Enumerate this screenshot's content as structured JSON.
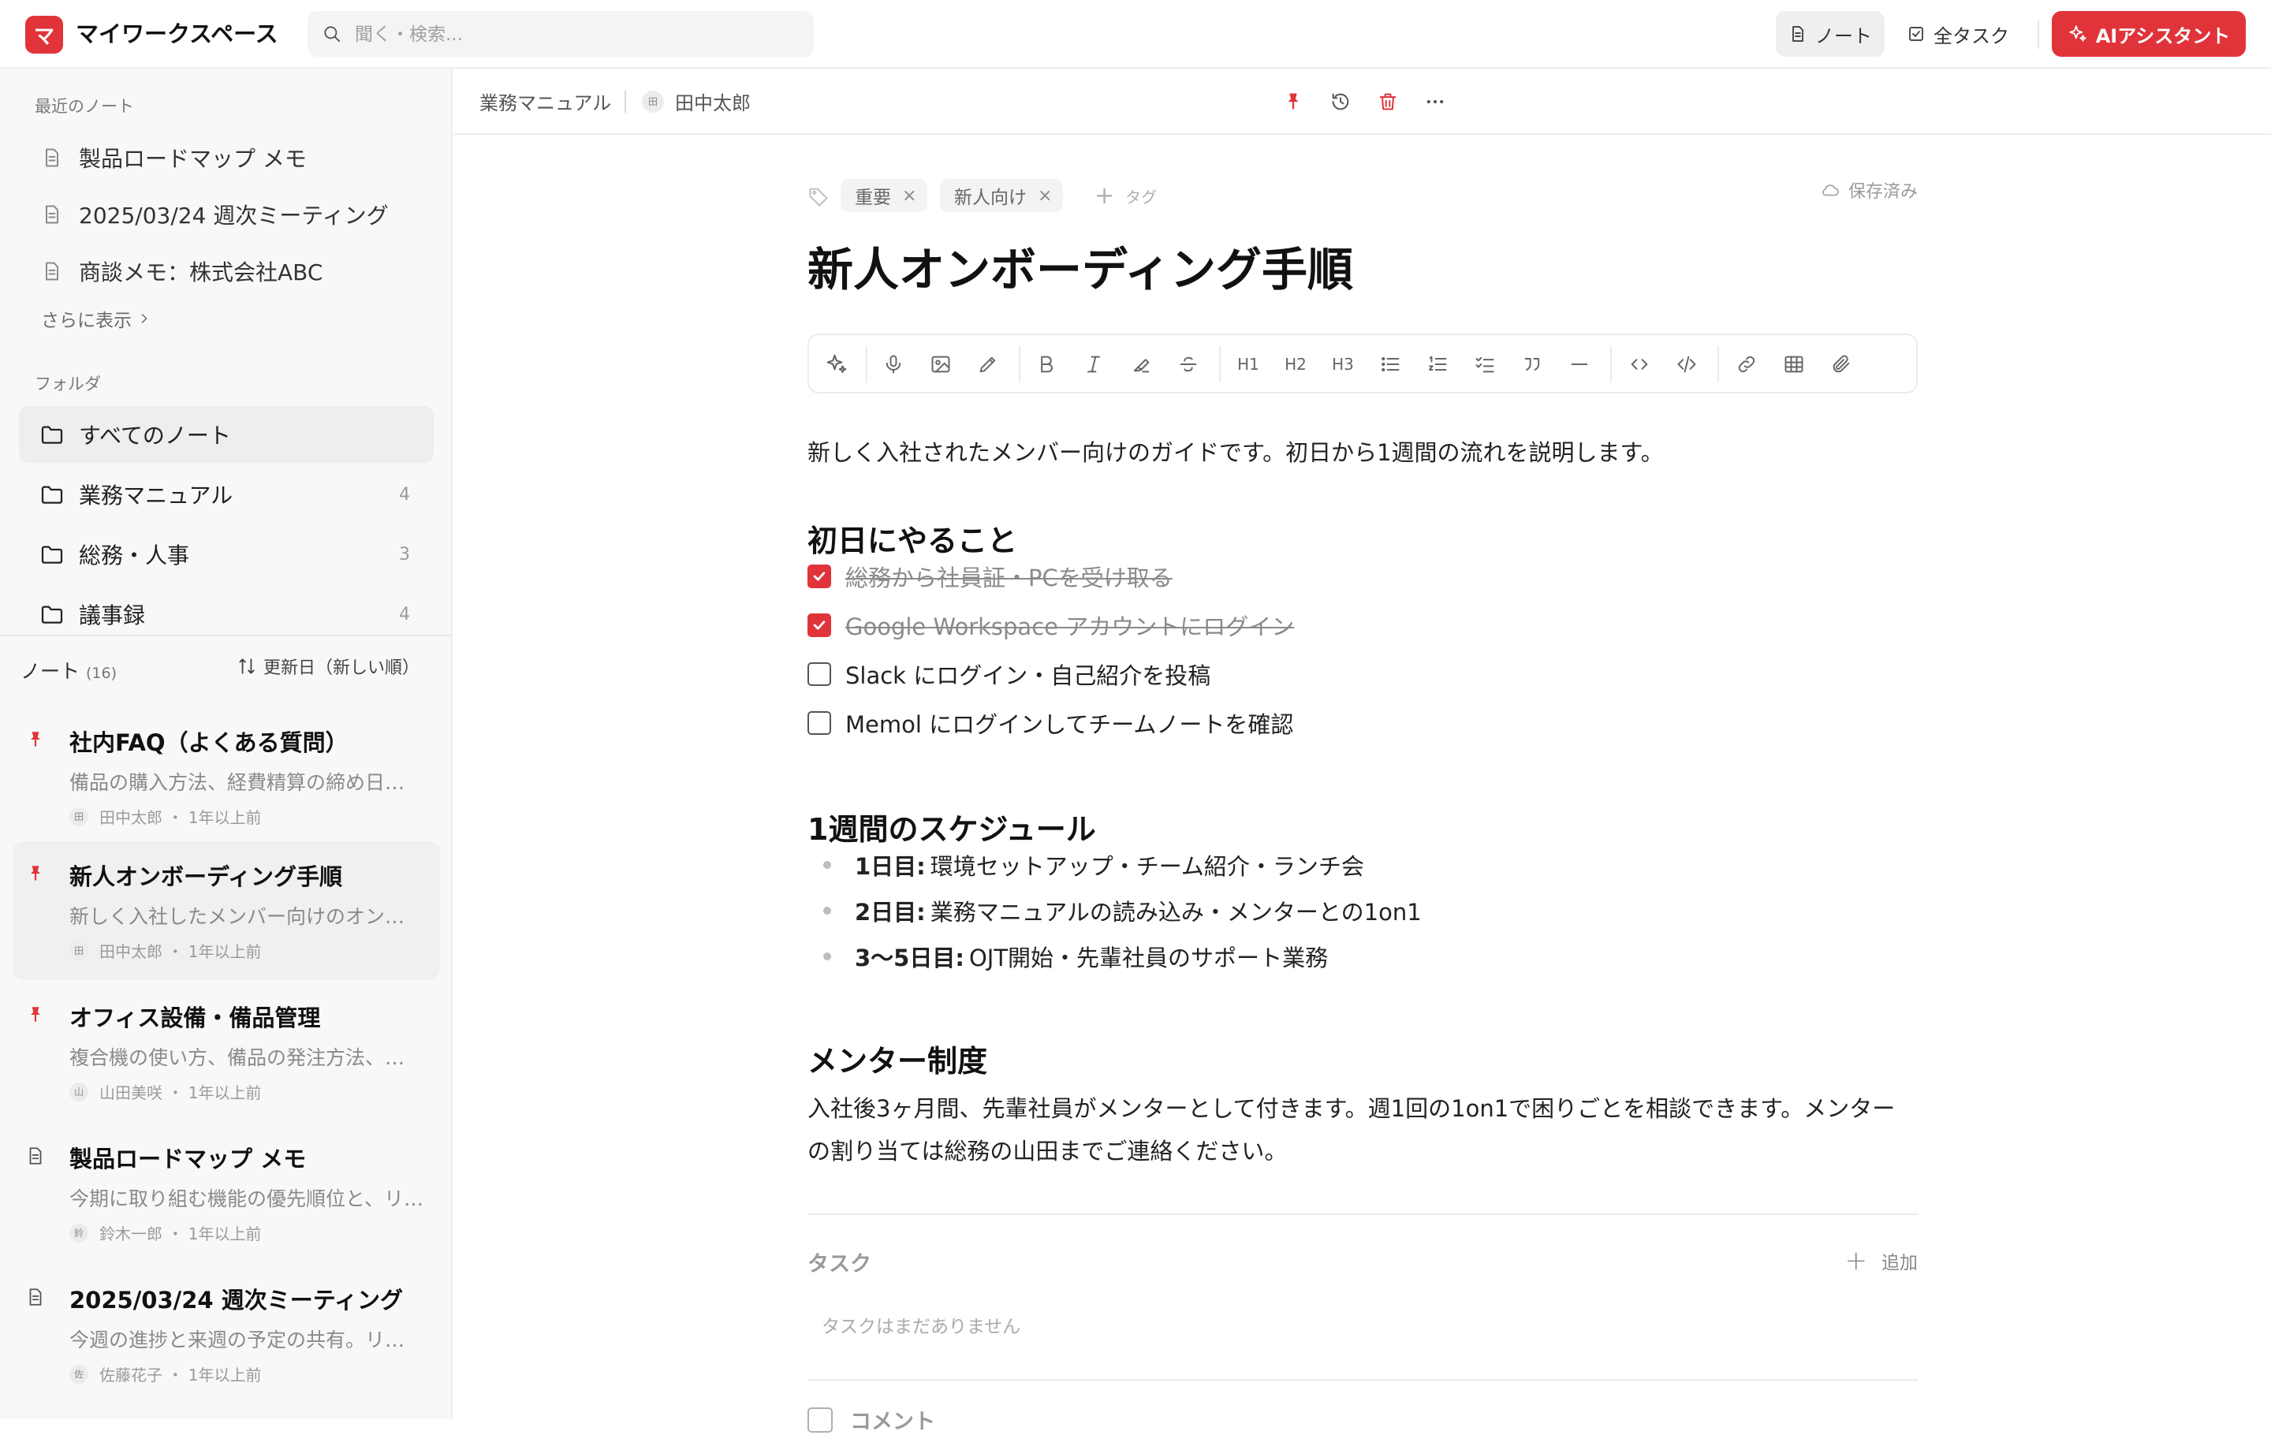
{
  "app": {
    "logo_letter": "マ",
    "workspace": "マイワークスペース",
    "search_placeholder": "聞く・検索...",
    "nav_notes": "ノート",
    "nav_tasks": "全タスク",
    "ai_button": "AIアシスタント",
    "accent_color": "#e0343a"
  },
  "sidebar": {
    "recent_label": "最近のノート",
    "recent": [
      {
        "label": "製品ロードマップ メモ"
      },
      {
        "label": "2025/03/24 週次ミーティング"
      },
      {
        "label": "商談メモ：株式会社ABC"
      }
    ],
    "show_more": "さらに表示",
    "folders_label": "フォルダ",
    "folders": [
      {
        "label": "すべてのノート",
        "count": ""
      },
      {
        "label": "業務マニュアル",
        "count": "4"
      },
      {
        "label": "総務・人事",
        "count": "3"
      },
      {
        "label": "議事録",
        "count": "4"
      }
    ],
    "notes_label": "ノート",
    "notes_count": "(16)",
    "sort_label": "更新日（新しい順）",
    "notes": [
      {
        "title": "社内FAQ（よくある質問）",
        "excerpt": "備品の購入方法、経費精算の締め日、各種申請",
        "author_initial": "田",
        "author": "田中太郎",
        "time": "1年以上前",
        "pinned": true
      },
      {
        "title": "新人オンボーディング手順",
        "excerpt": "新しく入社したメンバー向けのオンボーディング",
        "author_initial": "田",
        "author": "田中太郎",
        "time": "1年以上前",
        "pinned": true
      },
      {
        "title": "オフィス設備・備品管理",
        "excerpt": "複合機の使い方、備品の発注方法、会議室の予約",
        "author_initial": "山",
        "author": "山田美咲",
        "time": "1年以上前",
        "pinned": true
      },
      {
        "title": "製品ロードマップ メモ",
        "excerpt": "今期に取り組む機能の優先順位と、リリース予定",
        "author_initial": "鈴",
        "author": "鈴木一郎",
        "time": "1年以上前",
        "pinned": false
      },
      {
        "title": "2025/03/24 週次ミーティング",
        "excerpt": "今週の進捗と来週の予定の共有。リリース",
        "author_initial": "佐",
        "author": "佐藤花子",
        "time": "1年以上前",
        "pinned": false
      }
    ]
  },
  "breadcrumb": {
    "folder": "業務マニュアル",
    "author_initial": "田",
    "author": "田中太郎"
  },
  "note": {
    "tags": [
      "重要",
      "新人向け"
    ],
    "tag_remove": "×",
    "add_tag": "タグ",
    "saved": "保存済み",
    "title": "新人オンボーディング手順",
    "toolbar_labels": {
      "h1": "H1",
      "h2": "H2",
      "h3": "H3"
    },
    "intro": "新しく入社されたメンバー向けのガイドです。初日から1週間の流れを説明します。",
    "h_day1": "初日にやること",
    "checklist": [
      {
        "text": "総務から社員証・PCを受け取る",
        "done": true
      },
      {
        "text": "Google Workspace アカウントにログイン",
        "done": true
      },
      {
        "text": "Slack にログイン・自己紹介を投稿",
        "done": false
      },
      {
        "text": "Memol にログインしてチームノートを確認",
        "done": false
      }
    ],
    "h_week": "1週間のスケジュール",
    "schedule": [
      {
        "label": "1日目:",
        "text": "環境セットアップ・チーム紹介・ランチ会"
      },
      {
        "label": "2日目:",
        "text": "業務マニュアルの読み込み・メンターとの1on1"
      },
      {
        "label": "3〜5日目:",
        "text": "OJT開始・先輩社員のサポート業務"
      }
    ],
    "h_mentor": "メンター制度",
    "mentor_text": "入社後3ヶ月間、先輩社員がメンターとして付きます。週1回の1on1で困りごとを相談できます。メンターの割り当ては総務の山田までご連絡ください。",
    "tasks_label": "タスク",
    "tasks_add": "追加",
    "tasks_empty": "タスクはまだありません",
    "comments_label": "コメント"
  }
}
